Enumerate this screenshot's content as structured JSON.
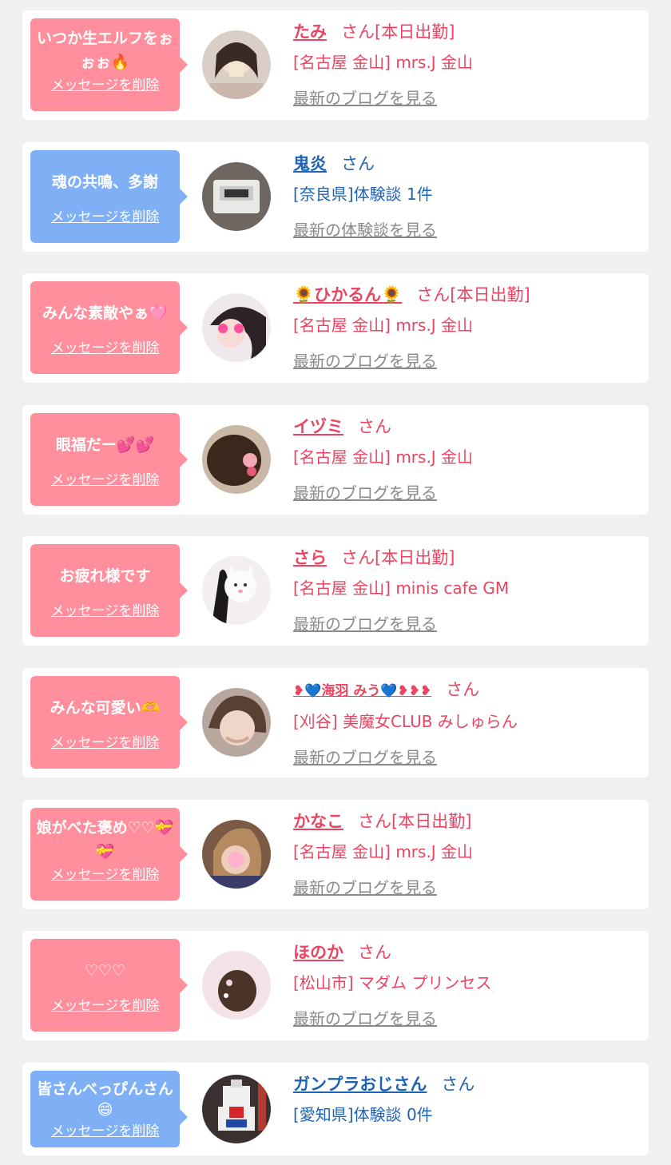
{
  "cards": [
    {
      "theme": "pink",
      "message": "いつか生エルフをぉぉぉ🔥",
      "delete_label": "メッセージを削除",
      "name": "たみ",
      "honorific": "さん[本日出勤]",
      "shop": "[名古屋 金山] mrs.J 金山",
      "link": "最新のブログを見る",
      "avatar_icon": "woman-photo-avatar"
    },
    {
      "theme": "blue",
      "message": "魂の共鳴、多謝",
      "delete_label": "メッセージを削除",
      "name": "鬼炎",
      "honorific": "さん",
      "shop": "[奈良県]体験談 1件",
      "link": "最新の体験談を見る",
      "avatar_icon": "clock-display-avatar"
    },
    {
      "theme": "pink",
      "message": "みんな素敵やぁ🩷",
      "delete_label": "メッセージを削除",
      "name": "🌻ひかるん🌻",
      "honorific": "さん[本日出勤]",
      "shop": "[名古屋 金山] mrs.J 金山",
      "link": "最新のブログを見る",
      "avatar_icon": "woman-photo-avatar"
    },
    {
      "theme": "pink",
      "message": "眼福だー💕💕",
      "delete_label": "メッセージを削除",
      "name": "イヅミ",
      "honorific": "さん",
      "shop": "[名古屋 金山] mrs.J 金山",
      "link": "最新のブログを見る",
      "avatar_icon": "hair-photo-avatar"
    },
    {
      "theme": "pink",
      "message": "お疲れ様です",
      "delete_label": "メッセージを削除",
      "name": "さら",
      "honorific": "さん[本日出勤]",
      "shop": "[名古屋 金山] minis cafe GM",
      "link": "最新のブログを見る",
      "avatar_icon": "cat-plush-photo-avatar"
    },
    {
      "theme": "pink",
      "message": "みんな可愛い🫶",
      "delete_label": "メッセージを削除",
      "name": "❥💙海羽 みう💙❥❥❥",
      "honorific": "さん",
      "shop": "[刈谷] 美魔女CLUB みしゅらん",
      "link": "最新のブログを見る",
      "avatar_icon": "woman-photo-avatar"
    },
    {
      "theme": "pink",
      "message": "娘がべた褒め♡♡💝💝",
      "delete_label": "メッセージを削除",
      "name": "かなこ",
      "honorific": "さん[本日出勤]",
      "shop": "[名古屋 金山] mrs.J 金山",
      "link": "最新のブログを見る",
      "avatar_icon": "woman-photo-avatar"
    },
    {
      "theme": "pink",
      "message": "♡♡♡",
      "delete_label": "メッセージを削除",
      "name": "ほのか",
      "honorific": "さん",
      "shop": "[松山市] マダム プリンセス",
      "link": "最新のブログを見る",
      "avatar_icon": "hair-photo-avatar"
    },
    {
      "theme": "blue",
      "message": "皆さんべっぴんさん😄",
      "delete_label": "メッセージを削除",
      "name": "ガンプラおじさん",
      "honorific": "さん",
      "shop": "[愛知県]体験談 0件",
      "link": "",
      "avatar_icon": "robot-model-avatar"
    }
  ],
  "colors": {
    "pink_bubble": "#ff8f9d",
    "blue_bubble": "#7fb0f5",
    "pink_text": "#e94562",
    "blue_text": "#1f64b4",
    "link_gray": "#8a8a8a"
  }
}
